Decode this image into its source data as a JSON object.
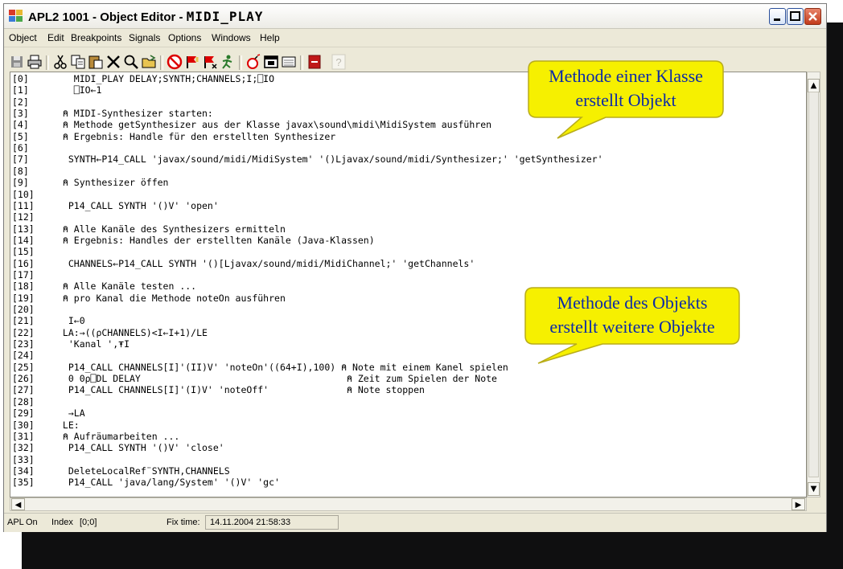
{
  "window": {
    "title_prefix": "APL2 1001 - Object Editor - ",
    "title_object": "MIDI_PLAY",
    "menu": [
      "Object",
      "Edit",
      "Breakpoints",
      "Signals",
      "Options",
      "Windows",
      "Help"
    ],
    "toolbar_icons": [
      "save-icon",
      "print-icon",
      "cut-icon",
      "copy-icon",
      "paste-icon",
      "delete-icon",
      "find-icon",
      "open-icon",
      "stop-icon",
      "breakpoint-set-icon",
      "breakpoint-clear-icon",
      "run-icon",
      "bomb-icon",
      "window-icon",
      "keyboard-icon",
      "exit-icon",
      "help-icon"
    ]
  },
  "code": [
    {
      "n": "[0]",
      "t": "   MIDI_PLAY DELAY;SYNTH;CHANNELS;I;⎕IO"
    },
    {
      "n": "[1]",
      "t": "   ⎕IO←1"
    },
    {
      "n": "[2]",
      "t": ""
    },
    {
      "n": "[3]",
      "t": " ⍝ MIDI-Synthesizer starten:"
    },
    {
      "n": "[4]",
      "t": " ⍝ Methode getSynthesizer aus der Klasse javax\\sound\\midi\\MidiSystem ausführen"
    },
    {
      "n": "[5]",
      "t": " ⍝ Ergebnis: Handle für den erstellten Synthesizer"
    },
    {
      "n": "[6]",
      "t": ""
    },
    {
      "n": "[7]",
      "t": "  SYNTH←P14_CALL 'javax/sound/midi/MidiSystem' '()Ljavax/sound/midi/Synthesizer;' 'getSynthesizer'"
    },
    {
      "n": "[8]",
      "t": ""
    },
    {
      "n": "[9]",
      "t": " ⍝ Synthesizer öffen"
    },
    {
      "n": "[10]",
      "t": ""
    },
    {
      "n": "[11]",
      "t": "  P14_CALL SYNTH '()V' 'open'"
    },
    {
      "n": "[12]",
      "t": ""
    },
    {
      "n": "[13]",
      "t": " ⍝ Alle Kanäle des Synthesizers ermitteln"
    },
    {
      "n": "[14]",
      "t": " ⍝ Ergebnis: Handles der erstellten Kanäle (Java-Klassen)"
    },
    {
      "n": "[15]",
      "t": ""
    },
    {
      "n": "[16]",
      "t": "  CHANNELS←P14_CALL SYNTH '()[Ljavax/sound/midi/MidiChannel;' 'getChannels'"
    },
    {
      "n": "[17]",
      "t": ""
    },
    {
      "n": "[18]",
      "t": " ⍝ Alle Kanäle testen ..."
    },
    {
      "n": "[19]",
      "t": " ⍝ pro Kanal die Methode noteOn ausführen"
    },
    {
      "n": "[20]",
      "t": ""
    },
    {
      "n": "[21]",
      "t": "  I←0"
    },
    {
      "n": "[22]",
      "t": " LA:→((⍴CHANNELS)<I←I+1)/LE"
    },
    {
      "n": "[23]",
      "t": "  'Kanal ',⍕I"
    },
    {
      "n": "[24]",
      "t": ""
    },
    {
      "n": "[25]",
      "t": "  P14_CALL CHANNELS[I]'(II)V' 'noteOn'((64+I),100) ⍝ Note mit einem Kanel spielen"
    },
    {
      "n": "[26]",
      "t": "  0 0⍴⎕DL DELAY                                     ⍝ Zeit zum Spielen der Note"
    },
    {
      "n": "[27]",
      "t": "  P14_CALL CHANNELS[I]'(I)V' 'noteOff'              ⍝ Note stoppen"
    },
    {
      "n": "[28]",
      "t": ""
    },
    {
      "n": "[29]",
      "t": "  →LA"
    },
    {
      "n": "[30]",
      "t": " LE:"
    },
    {
      "n": "[31]",
      "t": " ⍝ Aufräumarbeiten ..."
    },
    {
      "n": "[32]",
      "t": "  P14_CALL SYNTH '()V' 'close'"
    },
    {
      "n": "[33]",
      "t": ""
    },
    {
      "n": "[34]",
      "t": "  DeleteLocalRef¨SYNTH,CHANNELS"
    },
    {
      "n": "[35]",
      "t": "  P14_CALL 'java/lang/System' '()V' 'gc'"
    }
  ],
  "status": {
    "mode_label": "APL",
    "mode_value": "On",
    "index_label": "Index",
    "index_value": "[0;0]",
    "fixtime_label": "Fix time:",
    "fixtime_value": "14.11.2004 21:58:33"
  },
  "callouts": [
    {
      "line1": "Methode einer Klasse",
      "line2": "erstellt Objekt"
    },
    {
      "line1": "Methode des Objekts",
      "line2": "erstellt weitere Objekte"
    }
  ],
  "colors": {
    "accent": "#2b5fd9",
    "callout_fill": "#f6f000",
    "callout_text": "#0c2aa8",
    "shadow": "#0f0f10"
  }
}
